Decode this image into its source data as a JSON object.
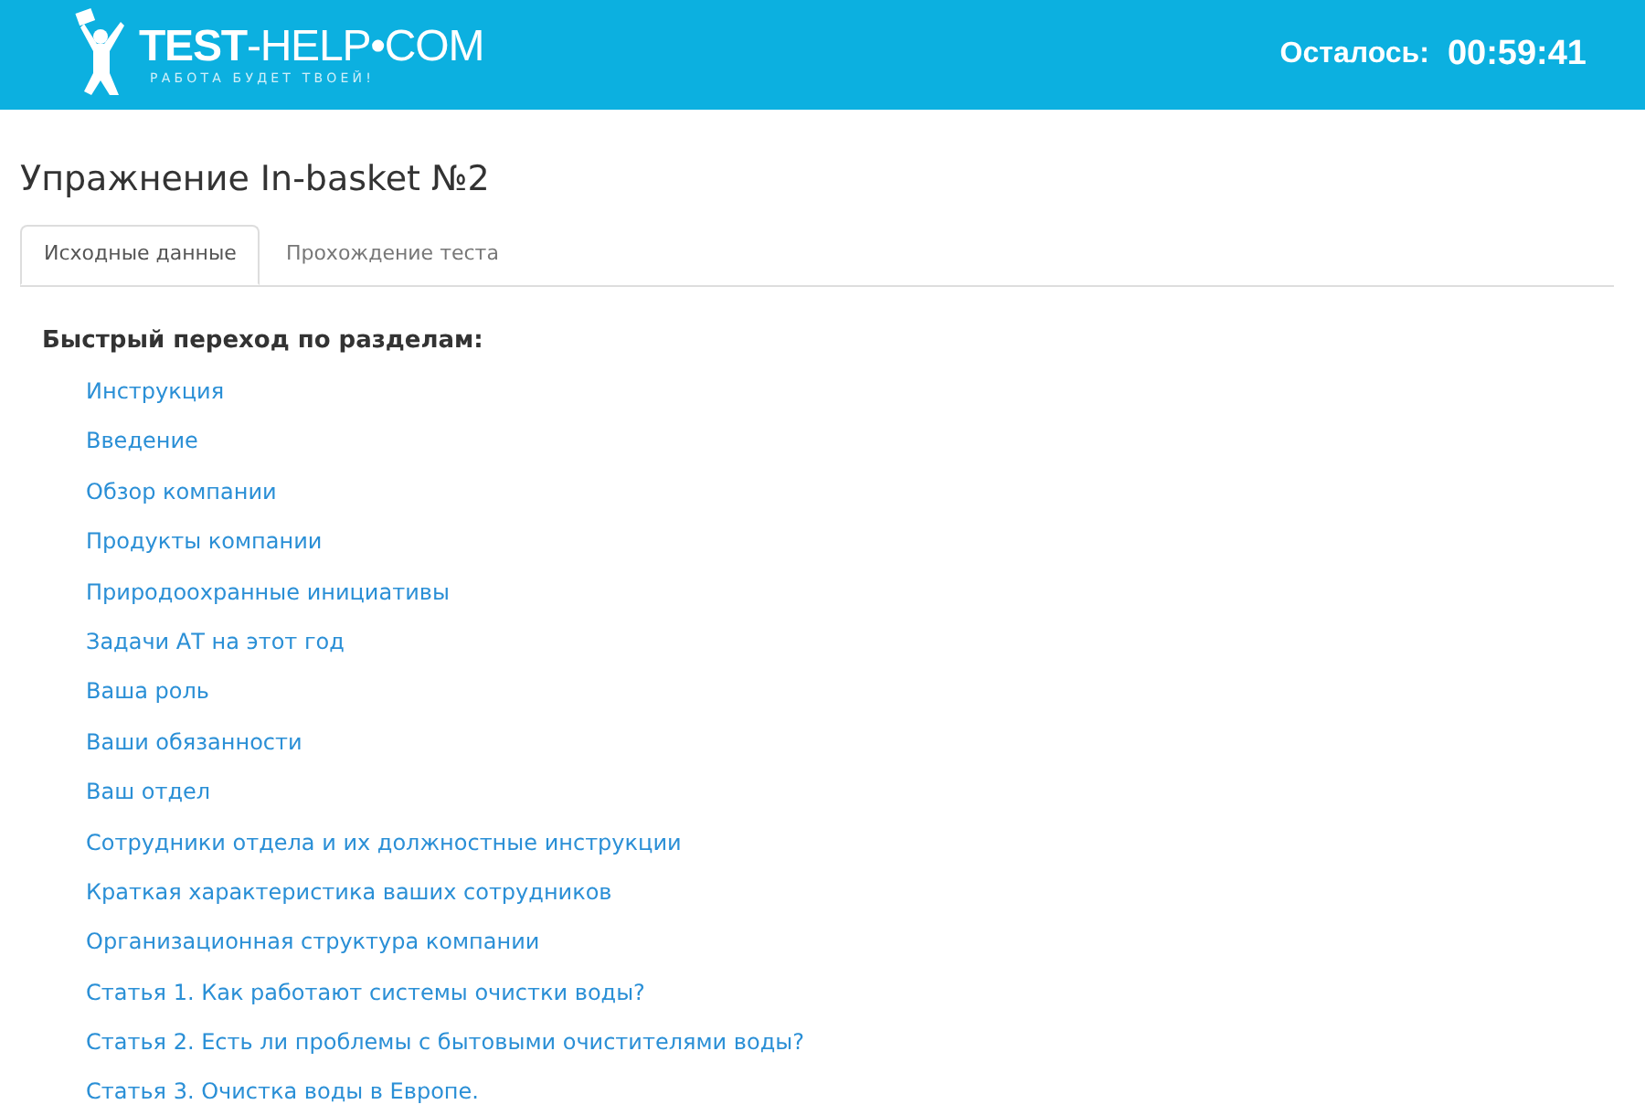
{
  "header": {
    "logo": {
      "name": "**TEST**-HELP•COM",
      "tagline": "РАБОТА БУДЕТ ТВОЕЙ!"
    },
    "timer_label": "Осталось:",
    "timer": "00:59:41"
  },
  "title": "Упражнение In-basket №2",
  "tabs": [
    {
      "label": "Исходные данные",
      "selected": true
    },
    {
      "label": "Прохождение теста",
      "selected": false
    }
  ],
  "sections": {
    "heading": "Быстрый переход по разделам:",
    "links": [
      "Инструкция",
      "Введение",
      "Обзор компании",
      "Продукты компании",
      "Природоохранные инициативы",
      "Задачи АТ на этот год",
      "Ваша роль",
      "Ваши обязанности",
      "Ваш отдел",
      "Сотрудники отдела и их должностные инструкции",
      "Краткая характеристика ваших сотрудников",
      "Организационная структура компании",
      "Статья 1. Как работают системы очистки воды?",
      "Статья 2. Есть ли проблемы с бытовыми очистителями воды?",
      "Статья 3. Очистка воды в Европе."
    ]
  }
}
